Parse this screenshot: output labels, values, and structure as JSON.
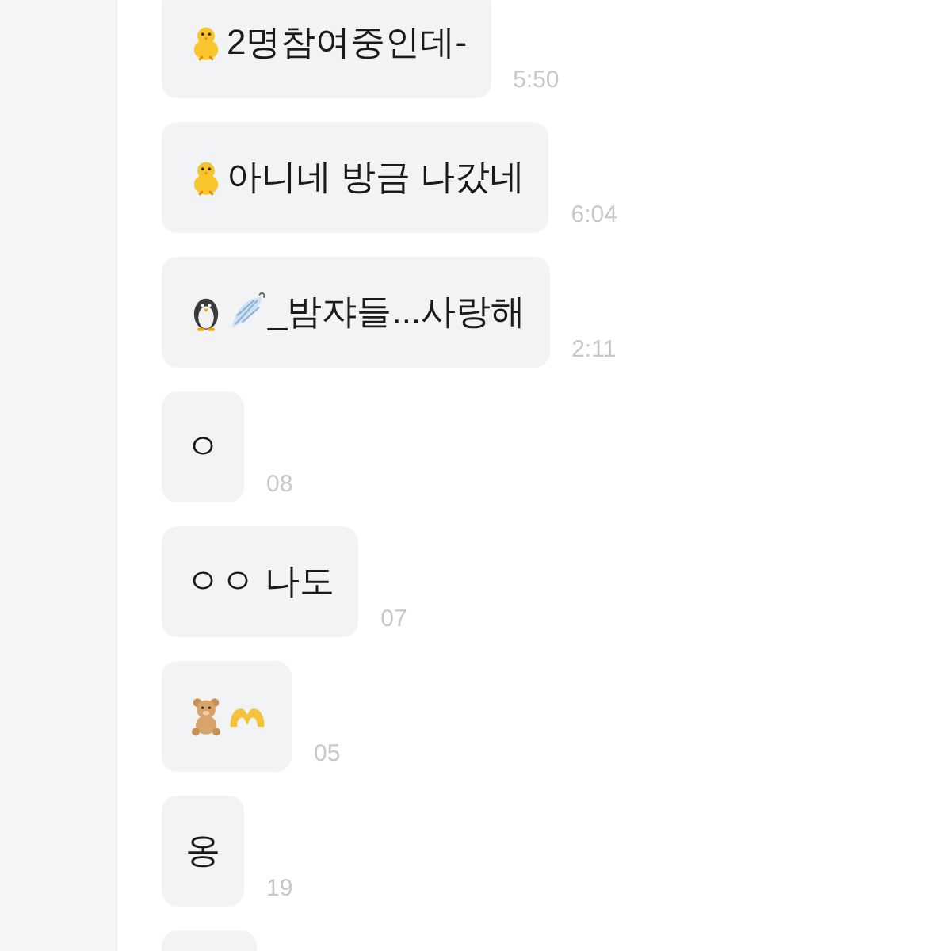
{
  "messages": [
    {
      "parts": [
        {
          "kind": "chick"
        },
        {
          "kind": "text",
          "text": "2명참여중인데-"
        }
      ],
      "time": "5:50"
    },
    {
      "parts": [
        {
          "kind": "chick"
        },
        {
          "kind": "text",
          "text": "아니네 방금 나갔네"
        }
      ],
      "time": "6:04"
    },
    {
      "parts": [
        {
          "kind": "penguin"
        },
        {
          "kind": "wing"
        },
        {
          "kind": "text",
          "text": "_밤쟈들...사랑해"
        }
      ],
      "time": "2:11"
    },
    {
      "parts": [
        {
          "kind": "text",
          "text": "ㅇ"
        }
      ],
      "time": "08"
    },
    {
      "parts": [
        {
          "kind": "text",
          "text": "ㅇㅇ 나도"
        }
      ],
      "time": "07"
    },
    {
      "parts": [
        {
          "kind": "bear"
        },
        {
          "kind": "heart-hands"
        }
      ],
      "time": "05"
    },
    {
      "parts": [
        {
          "kind": "text",
          "text": "옹"
        }
      ],
      "time": "19"
    }
  ],
  "cut_off_bubble": true
}
